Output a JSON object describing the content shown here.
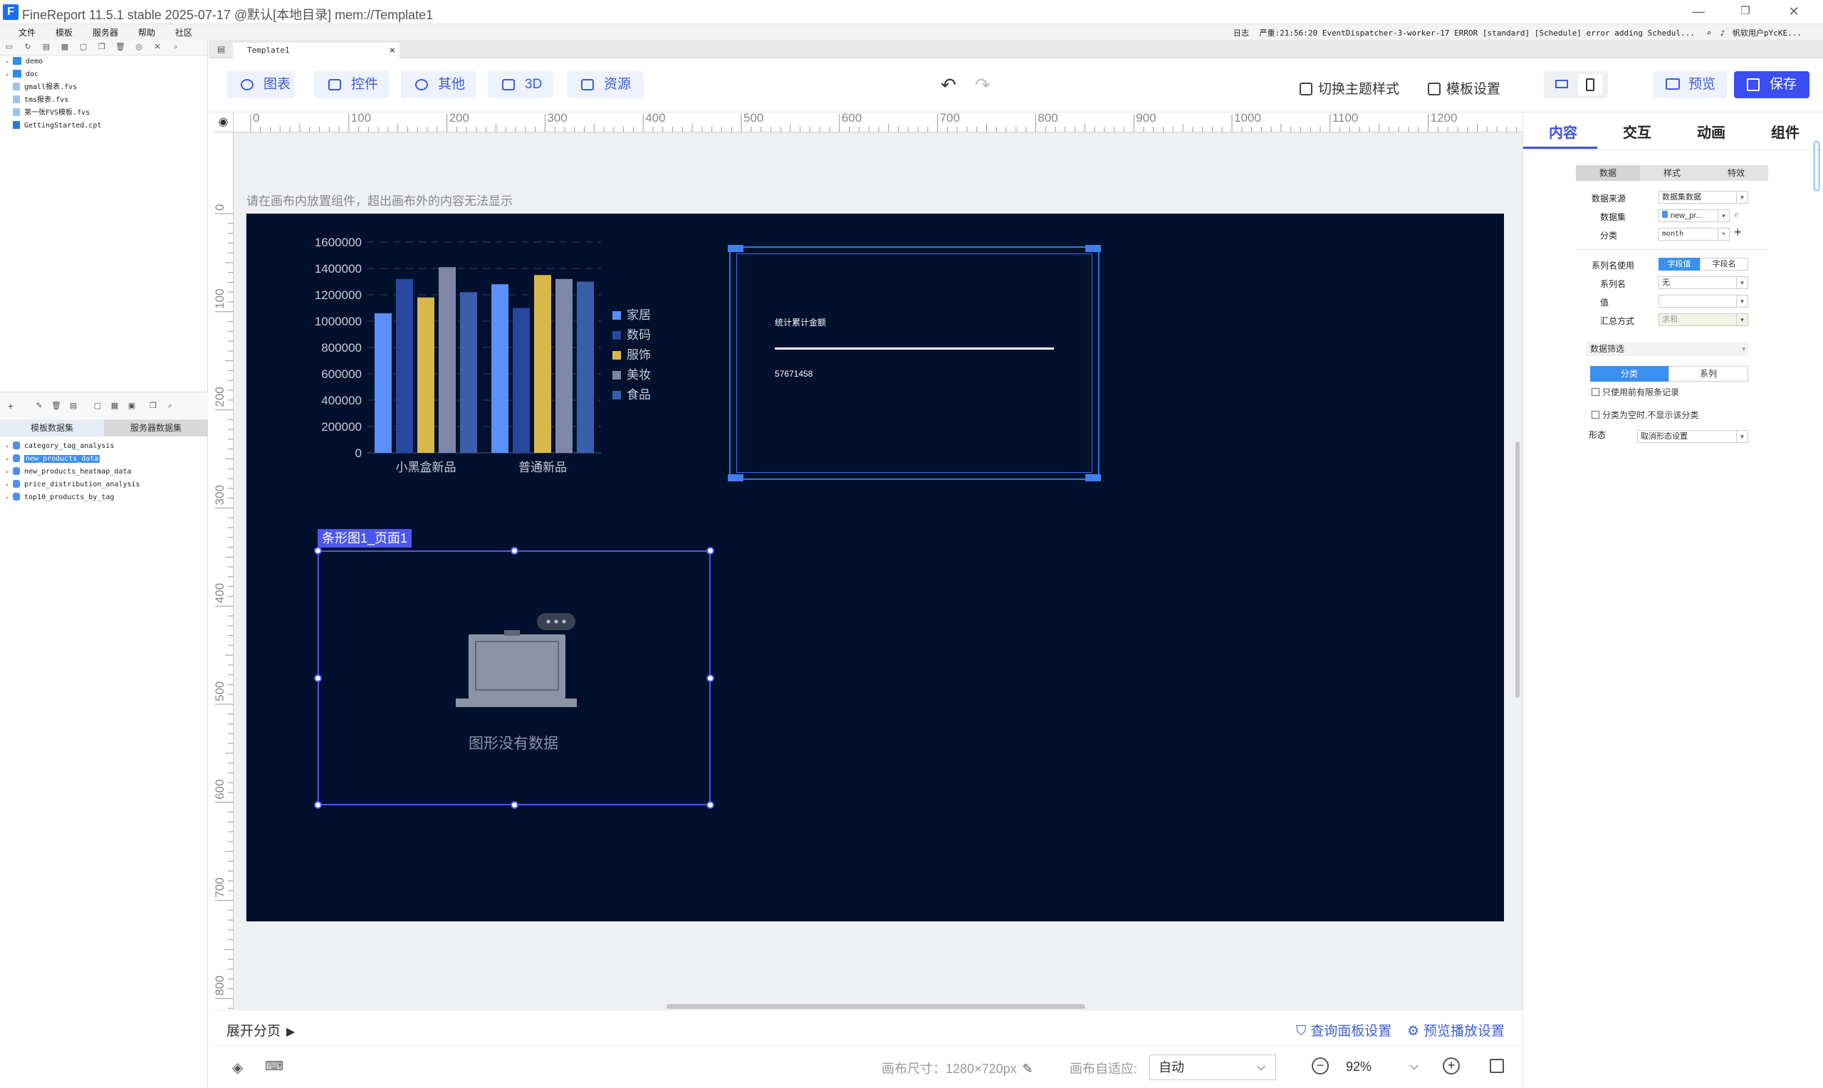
{
  "window": {
    "logo": "F",
    "title": "FineReport 11.5.1 stable 2025-07-17 @默认[本地目录]    mem://Template1",
    "minimize": "—",
    "restore": "❐",
    "close": "✕"
  },
  "menu": [
    "文件",
    "模板",
    "服务器",
    "帮助",
    "社区"
  ],
  "status": {
    "log_label": "日志",
    "log_text": "严重:21:56:20 EventDispatcher-3-worker-17 ERROR [standard] [Schedule] error adding Schedul...",
    "user": "帆软用户pYcKE..."
  },
  "template_tree": [
    {
      "label": "demo",
      "type": "folder"
    },
    {
      "label": "doc",
      "type": "folder"
    },
    {
      "label": "gmall报表.fvs",
      "type": "file"
    },
    {
      "label": "tms报表.fvs",
      "type": "file"
    },
    {
      "label": "第一张FVS模板.fvs",
      "type": "file"
    },
    {
      "label": "GettingStarted.cpt",
      "type": "cpt"
    }
  ],
  "dataset_tabs": [
    "模板数据集",
    "服务器数据集"
  ],
  "datasets": [
    "category_tag_analysis",
    "new_products_data",
    "new_products_heatmap_data",
    "price_distribution_analysis",
    "top10_products_by_tag"
  ],
  "doc_tab": {
    "label": "Template1",
    "close": "×"
  },
  "toolbar": {
    "chart": "图表",
    "widget": "控件",
    "other": "其他",
    "three_d": "3D",
    "resource": "资源",
    "undo": "↶",
    "redo": "↷",
    "theme": "切换主题样式",
    "template_settings": "模板设置",
    "preview": "预览",
    "save": "保存"
  },
  "ruler": {
    "top": [
      "0",
      "100",
      "200",
      "300",
      "400",
      "500",
      "600",
      "700",
      "800",
      "900",
      "1000",
      "1100",
      "1200"
    ],
    "left": [
      "0",
      "100",
      "200",
      "300",
      "400",
      "500",
      "600",
      "700",
      "800"
    ]
  },
  "canvas_hint": "请在画布内放置组件，超出画布外的内容无法显示",
  "chart_data": {
    "type": "bar",
    "categories": [
      "小黑盒新品",
      "普通新品"
    ],
    "series": [
      {
        "name": "家居",
        "color": "#5b8ff9",
        "values": [
          1060000,
          1280000
        ]
      },
      {
        "name": "数码",
        "color": "#28479e",
        "values": [
          1320000,
          1100000
        ]
      },
      {
        "name": "服饰",
        "color": "#d7b84a",
        "values": [
          1180000,
          1350000
        ]
      },
      {
        "name": "美妆",
        "color": "#7f86a8",
        "values": [
          1410000,
          1320000
        ]
      },
      {
        "name": "食品",
        "color": "#395fab",
        "values": [
          1220000,
          1300000
        ]
      }
    ],
    "yticks": [
      "1600000",
      "1400000",
      "1200000",
      "1000000",
      "800000",
      "600000",
      "400000",
      "200000",
      "0"
    ],
    "ylim": [
      0,
      1600000
    ],
    "legend": "right",
    "grid": true
  },
  "kpi": {
    "title": "统计累计金额",
    "value": "57671458"
  },
  "selected_widget": {
    "label": "条形图1_页面1",
    "empty_text": "图形没有数据"
  },
  "bottom": {
    "expand_pages": "展开分页",
    "query_panel": "查询面板设置",
    "preview_play": "预览播放设置",
    "canvas_size_label": "画布尺寸：",
    "canvas_size": "1280×720px",
    "adapt_label": "画布自适应:",
    "adapt_value": "自动",
    "zoom": "92%",
    "zoom_out": "−",
    "zoom_in": "+"
  },
  "right_panel": {
    "tabs": [
      "内容",
      "交互",
      "动画",
      "组件"
    ],
    "subtabs": [
      "数据",
      "样式",
      "特效"
    ],
    "data_source_label": "数据来源",
    "data_source_value": "数据集数据",
    "dataset_label": "数据集",
    "dataset_value": "new_pr...",
    "category_label": "分类",
    "category_value": "month",
    "series_name_use_label": "系列名使用",
    "series_name_use_opts": [
      "字段值",
      "字段名"
    ],
    "series_name_label": "系列名",
    "series_name_value": "无",
    "value_label": "值",
    "value_value": "",
    "summary_label": "汇总方式",
    "summary_value": "求和",
    "filter_label": "数据筛选",
    "filter_tabs": [
      "分类",
      "系列"
    ],
    "only_first_label": "只使用前有限条记录",
    "hide_empty_label": "分类为空时,不显示该分类",
    "form_label": "形态",
    "form_value": "取消形态设置"
  }
}
